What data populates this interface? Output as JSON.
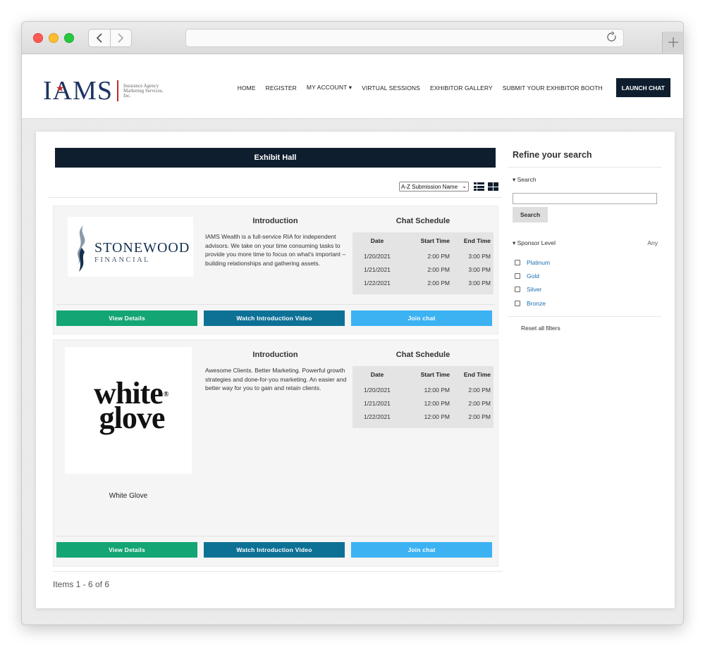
{
  "browser": {
    "back_icon": "chevron-left-icon",
    "forward_icon": "chevron-right-icon",
    "reload_icon": "reload-icon",
    "new_tab_icon": "plus-icon",
    "url": ""
  },
  "header": {
    "logo_text": "IAMS",
    "logo_subtitle": "Insurance Agency Marketing Services, Inc.",
    "nav": [
      {
        "label": "HOME"
      },
      {
        "label": "REGISTER"
      },
      {
        "label": "MY ACCOUNT ▾"
      },
      {
        "label": "VIRTUAL SESSIONS"
      },
      {
        "label": "EXHIBITOR GALLERY"
      },
      {
        "label": "SUBMIT YOUR EXHIBITOR BOOTH"
      }
    ],
    "launch_chat": "LAUNCH CHAT"
  },
  "main": {
    "title": "Exhibit Hall",
    "sort_selected": "A-Z Submission Name",
    "list_view_icon": "list-view-icon",
    "grid_view_icon": "grid-view-icon",
    "exhibitors": [
      {
        "logo_name": "STONEWOOD",
        "logo_sub": "FINANCIAL",
        "company_name": "",
        "intro_heading": "Introduction",
        "intro_text": "IAMS Wealth is a full-service RIA for independent advisors. We take on your time consuming tasks to provide you more time to focus on what's important – building relationships and gathering assets.",
        "chat_heading": "Chat Schedule",
        "schedule_headers": [
          "Date",
          "Start Time",
          "End Time"
        ],
        "schedule": [
          {
            "date": "1/20/2021",
            "start": "2:00 PM",
            "end": "3:00 PM"
          },
          {
            "date": "1/21/2021",
            "start": "2:00 PM",
            "end": "3:00 PM"
          },
          {
            "date": "1/22/2021",
            "start": "2:00 PM",
            "end": "3:00 PM"
          }
        ],
        "buttons": {
          "details": "View Details",
          "video": "Watch Introduction Video",
          "chat": "Join chat"
        }
      },
      {
        "logo_line1": "white",
        "logo_line2": "glove",
        "logo_reg": "®",
        "company_name": "White Glove",
        "intro_heading": "Introduction",
        "intro_text": "Awesome Clients. Better Marketing. Powerful growth strategies and done-for-you marketing. An easier and better way for you to gain and retain clients.",
        "chat_heading": "Chat Schedule",
        "schedule_headers": [
          "Date",
          "Start Time",
          "End Time"
        ],
        "schedule": [
          {
            "date": "1/20/2021",
            "start": "12:00 PM",
            "end": "2:00 PM"
          },
          {
            "date": "1/21/2021",
            "start": "12:00 PM",
            "end": "2:00 PM"
          },
          {
            "date": "1/22/2021",
            "start": "12:00 PM",
            "end": "2:00 PM"
          }
        ],
        "buttons": {
          "details": "View Details",
          "video": "Watch Introduction Video",
          "chat": "Join chat"
        }
      }
    ],
    "items_count": "Items 1 - 6 of 6"
  },
  "sidebar": {
    "title": "Refine your search",
    "search_label": "▾ Search",
    "search_value": "",
    "search_button": "Search",
    "sponsor_label": "▾ Sponsor Level",
    "sponsor_any": "Any",
    "levels": [
      "Platinum",
      "Gold",
      "Silver",
      "Bronze"
    ],
    "reset": "Reset all filters"
  },
  "colors": {
    "navy": "#0f1e2e",
    "details_green": "#13a574",
    "video_blue": "#0d7196",
    "chat_blue": "#3cb2f3",
    "brand_red": "#c0292f",
    "link_blue": "#1a6eb0"
  }
}
